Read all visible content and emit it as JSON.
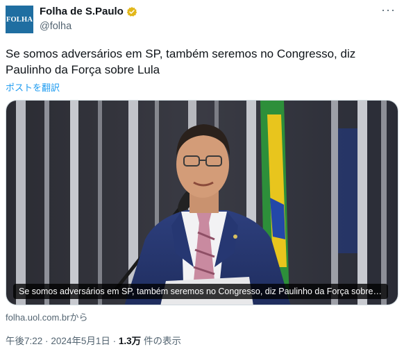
{
  "account": {
    "avatar_text": "FOLHA",
    "name": "Folha de S.Paulo",
    "handle": "@folha",
    "verified_icon": "gold-verified-badge"
  },
  "tweet": {
    "text": "Se somos adversários em SP, também seremos no Congresso, diz Paulinho da Força sobre Lula",
    "translate_label": "ポストを翻訳"
  },
  "card": {
    "caption": "Se somos adversários em SP, também seremos no Congresso, diz Paulinho da Força sobre ...",
    "source": "folha.uol.com.brから"
  },
  "meta": {
    "time": "午後7:22",
    "date": "2024年5月1日",
    "views_count": "1.3万",
    "views_label": "件の表示",
    "separator": "·"
  },
  "colors": {
    "accent": "#1d9bf0",
    "avatar_bg": "#1f6ea1",
    "verified": "#e2b719"
  }
}
